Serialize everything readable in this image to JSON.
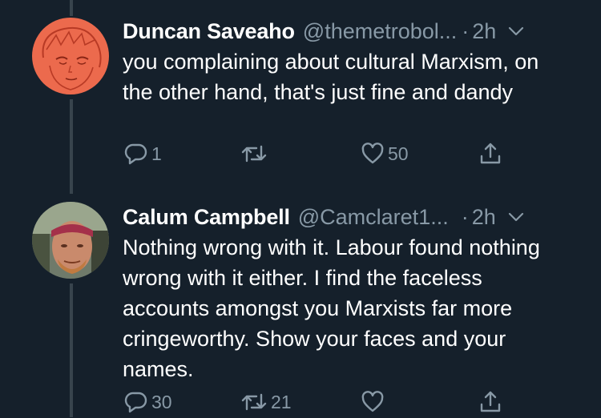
{
  "colors": {
    "background": "#15202b",
    "text": "#ffffff",
    "muted": "#8899a6",
    "thread_line": "#38444d"
  },
  "tweets": [
    {
      "name": "Duncan Saveaho",
      "handle": "@themetrobol...",
      "separator": "·",
      "time": "2h",
      "text": "you complaining about cultural Marxism, on the other hand, that's just fine and dandy",
      "reply_count": "1",
      "retweet_count": "",
      "like_count": "50",
      "avatar": "anime-sketch-avatar-orange"
    },
    {
      "name": "Calum Campbell",
      "handle": "@Camclaret1...",
      "separator": "·",
      "time": "2h",
      "text": "Nothing wrong with it. Labour found nothing wrong with it either. I find the faceless accounts amongst you Marxists far more cringeworthy. Show your faces and your names.",
      "reply_count": "30",
      "retweet_count": "21",
      "like_count": "",
      "avatar": "photo-avatar-man-headband"
    }
  ],
  "icons": {
    "reply": "reply-icon",
    "retweet": "retweet-icon",
    "like": "heart-icon",
    "share": "share-icon",
    "menu": "chevron-down-icon"
  }
}
